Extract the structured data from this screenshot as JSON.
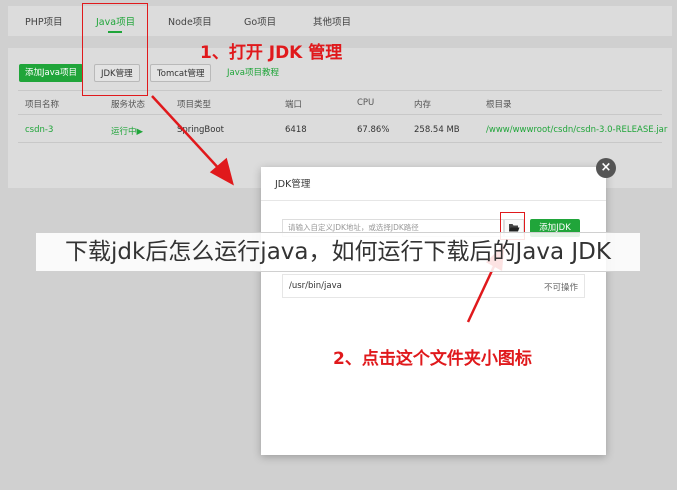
{
  "top_tabs": [
    "PHP项目",
    "Java项目",
    "Node项目",
    "Go项目",
    "其他项目"
  ],
  "toolbar": {
    "add_java_project": "添加Java项目",
    "jdk_manage": "JDK管理",
    "tomcat_manage": "Tomcat管理",
    "java_tutorial": "Java项目教程"
  },
  "table": {
    "headers": [
      "项目名称",
      "服务状态",
      "项目类型",
      "端口",
      "CPU",
      "内存",
      "根目录"
    ],
    "row": {
      "name": "csdn-3",
      "status": "运行中▶",
      "type": "SpringBoot",
      "port": "6418",
      "cpu": "67.86%",
      "memory": "258.54 MB",
      "root": "/www/wwwroot/csdn/csdn-3.0-RELEASE.jar"
    }
  },
  "annotations": {
    "step1": "1、打开 JDK 管理",
    "step2": "2、点击这个文件夹小图标"
  },
  "modal": {
    "title": "JDK管理",
    "close": "×",
    "input_placeholder": "请输入自定义JDK地址，或选择JDK路径",
    "add_button": "添加JDK",
    "jdk_path": "/usr/bin/java",
    "jdk_operation": "不可操作"
  },
  "caption": "下载jdk后怎么运行java，如何运行下载后的Java JDK",
  "colors": {
    "accent": "#20a53a",
    "annotation": "#e0191c"
  }
}
